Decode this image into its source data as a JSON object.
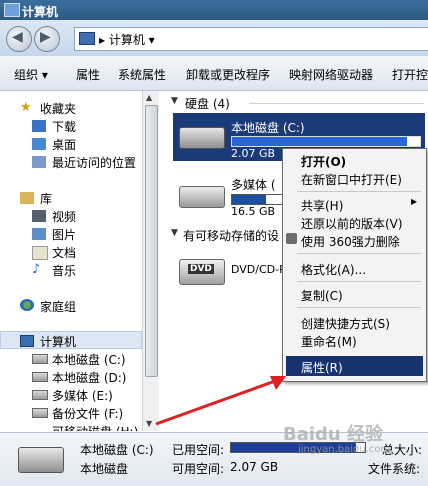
{
  "window": {
    "title": "计算机"
  },
  "address": {
    "path": "计算机"
  },
  "toolbar": {
    "items": [
      "组织 ▾",
      "属性",
      "系统属性",
      "卸载或更改程序",
      "映射网络驱动器",
      "打开控"
    ]
  },
  "nav": {
    "favorites": "收藏夹",
    "fav_items": [
      "下载",
      "桌面",
      "最近访问的位置"
    ],
    "libraries": "库",
    "lib_items": [
      "视频",
      "图片",
      "文档",
      "音乐"
    ],
    "homegroup": "家庭组",
    "computer": "计算机",
    "computer_items": [
      "本地磁盘 (C:)",
      "本地磁盘 (D:)",
      "多媒体 (E:)",
      "备份文件 (F:)",
      "可移动磁盘 (H:)"
    ]
  },
  "content": {
    "group_hdd": "硬盘 (4)",
    "drive_c_name": "本地磁盘 (C:)",
    "drive_c_free": "2.07 GB",
    "drive_c_fill": 0.93,
    "drive_e_name": "多媒体 (",
    "drive_e_free": "16.5 GB",
    "drive_e_fill": 0.55,
    "group_removable": "有可移动存储的设",
    "dvd_name": "DVD/CD-R"
  },
  "menu": {
    "items": [
      "打开(O)",
      "在新窗口中打开(E)",
      "共享(H)",
      "还原以前的版本(V)",
      "使用 360强力删除",
      "格式化(A)...",
      "复制(C)",
      "创建快捷方式(S)",
      "重命名(M)",
      "属性(R)"
    ]
  },
  "details": {
    "name": "本地磁盘 (C:)",
    "type": "本地磁盘",
    "used_label": "已用空间:",
    "free_label": "可用空间:",
    "free_value": "2.07 GB",
    "total_label": "总大小:",
    "fs_label": "文件系统:",
    "used_fraction": 0.93
  },
  "watermark": {
    "brand": "Baidu 经验",
    "url": "jingyan.baidu.com"
  }
}
